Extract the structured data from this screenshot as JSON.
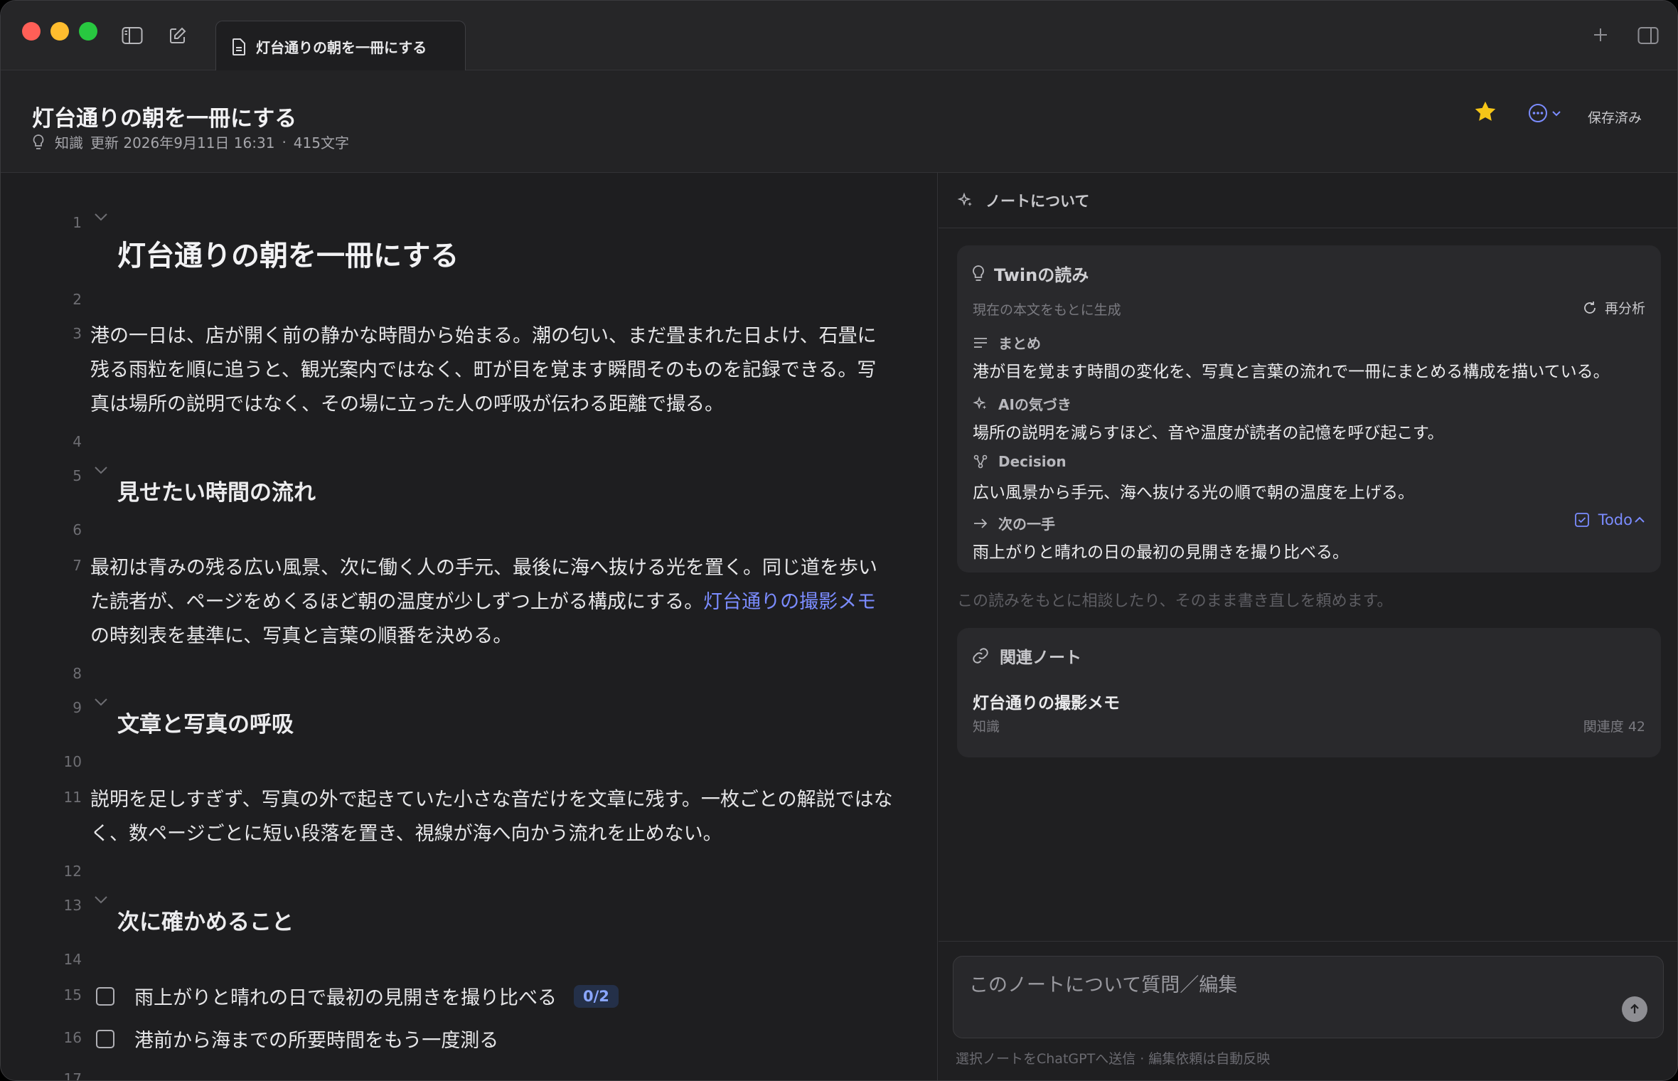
{
  "tab": {
    "label": "灯台通りの朝を一冊にする"
  },
  "header": {
    "title": "灯台通りの朝を一冊にする",
    "category": "知識",
    "updated": "更新 2026年9月11日 16:31",
    "separator": "·",
    "char_count": "415文字",
    "saved_label": "保存済み"
  },
  "editor": {
    "line_numbers": [
      "1",
      "2",
      "3",
      "4",
      "5",
      "6",
      "7",
      "8",
      "9",
      "10",
      "11",
      "12",
      "13",
      "14",
      "15",
      "16",
      "17"
    ],
    "h1": "灯台通りの朝を一冊にする",
    "para1": "港の一日は、店が開く前の静かな時間から始まる。潮の匂い、まだ畳まれた日よけ、石畳に残る雨粒を順に追うと、観光案内ではなく、町が目を覚ます瞬間そのものを記録できる。写真は場所の説明ではなく、その場に立った人の呼吸が伝わる距離で撮る。",
    "h2_1": "見せたい時間の流れ",
    "para2_before": "最初は青みの残る広い風景、次に働く人の手元、最後に海へ抜ける光を置く。同じ道を歩いた読者が、ページをめくるほど朝の温度が少しずつ上がる構成にする。",
    "para2_link": "灯台通りの撮影メモ",
    "para2_after": "の時刻表を基準に、写真と言葉の順番を決める。",
    "h2_2": "文章と写真の呼吸",
    "para3": "説明を足しすぎず、写真の外で起きていた小さな音だけを文章に残す。一枚ごとの解説ではなく、数ページごとに短い段落を置き、視線が海へ向かう流れを止めない。",
    "h2_3": "次に確かめること",
    "todos": [
      {
        "label": "雨上がりと晴れの日で最初の見開きを撮り比べる",
        "badge": "0/2"
      },
      {
        "label": "港前から海までの所要時間をもう一度測る"
      }
    ]
  },
  "panel": {
    "header": "ノートについて",
    "reading": {
      "title": "Twinの読み",
      "subtitle": "現在の本文をもとに生成",
      "reanalyze": "再分析",
      "summary_label": "まとめ",
      "summary_text": "港が目を覚ます時間の変化を、写真と言葉の流れで一冊にまとめる構成を描いている。",
      "insight_label": "AIの気づき",
      "insight_text": "場所の説明を減らすほど、音や温度が読者の記憶を呼び起こす。",
      "decision_label": "Decision",
      "decision_text": "広い風景から手元、海へ抜ける光の順で朝の温度を上げる。",
      "next_label": "次の一手",
      "next_text": "雨上がりと晴れの日の最初の見開きを撮り比べる。",
      "todo_link": "Todo"
    },
    "hint": "この読みをもとに相談したり、そのまま書き直しを頼めます。",
    "related": {
      "title": "関連ノート",
      "note": "灯台通りの撮影メモ",
      "category": "知識",
      "score": "関連度 42"
    },
    "input_placeholder": "このノートについて質問／編集",
    "footer": "選択ノートをChatGPTへ送信 · 編集依頼は自動反映"
  },
  "colors": {
    "accent": "#7b8cff",
    "star": "#f5c518",
    "background": "#1e1e20"
  }
}
